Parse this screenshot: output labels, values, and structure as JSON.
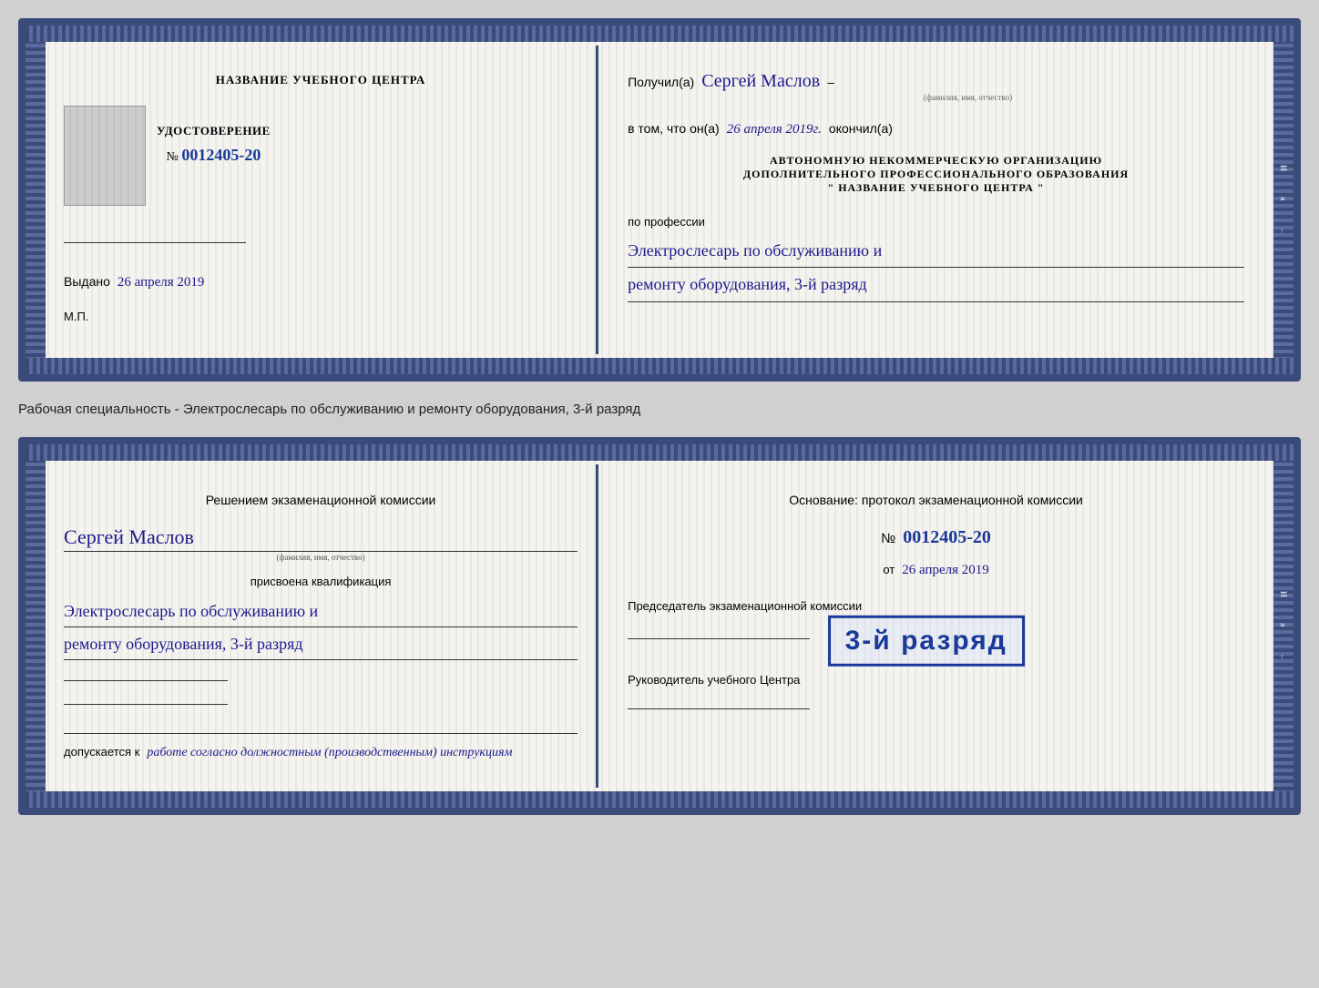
{
  "card1": {
    "left": {
      "title_line1": "НАЗВАНИЕ УЧЕБНОГО ЦЕНТРА",
      "cert_label": "УДОСТОВЕРЕНИЕ",
      "cert_number_label": "№",
      "cert_number": "0012405-20",
      "issued_label": "Выдано",
      "issued_date": "26 апреля 2019",
      "mp_label": "М.П."
    },
    "right": {
      "received_label": "Получил(а)",
      "recipient_name": "Сергей Маслов",
      "fio_label": "(фамилия, имя, отчество)",
      "date_label": "в том, что он(а)",
      "date_value": "26 апреля 2019г.",
      "finished_label": "окончил(а)",
      "org_line1": "АВТОНОМНУЮ НЕКОММЕРЧЕСКУЮ ОРГАНИЗАЦИЮ",
      "org_line2": "ДОПОЛНИТЕЛЬНОГО ПРОФЕССИОНАЛЬНОГО ОБРАЗОВАНИЯ",
      "org_line3": "\"  НАЗВАНИЕ УЧЕБНОГО ЦЕНТРА  \"",
      "profession_label": "по профессии",
      "profession_line1": "Электрослесарь по обслуживанию и",
      "profession_line2": "ремонту оборудования, 3-й разряд"
    }
  },
  "between_label": "Рабочая специальность - Электрослесарь по обслуживанию и ремонту оборудования, 3-й разряд",
  "card2": {
    "left": {
      "decision_label": "Решением экзаменационной  комиссии",
      "name": "Сергей Маслов",
      "fio_label": "(фамилия, имя, отчество)",
      "assigned_label": "присвоена квалификация",
      "qualification_line1": "Электрослесарь по обслуживанию и",
      "qualification_line2": "ремонту оборудования, 3-й разряд",
      "admitted_label": "допускается к",
      "admitted_value": "работе согласно должностным (производственным) инструкциям"
    },
    "right": {
      "basis_label": "Основание: протокол экзаменационной  комиссии",
      "number_label": "№",
      "number_value": "0012405-20",
      "date_label": "от",
      "date_value": "26 апреля 2019",
      "chairman_label": "Председатель экзаменационной комиссии",
      "director_label": "Руководитель учебного Центра"
    },
    "stamp": {
      "line1": "3-й разряд"
    }
  }
}
